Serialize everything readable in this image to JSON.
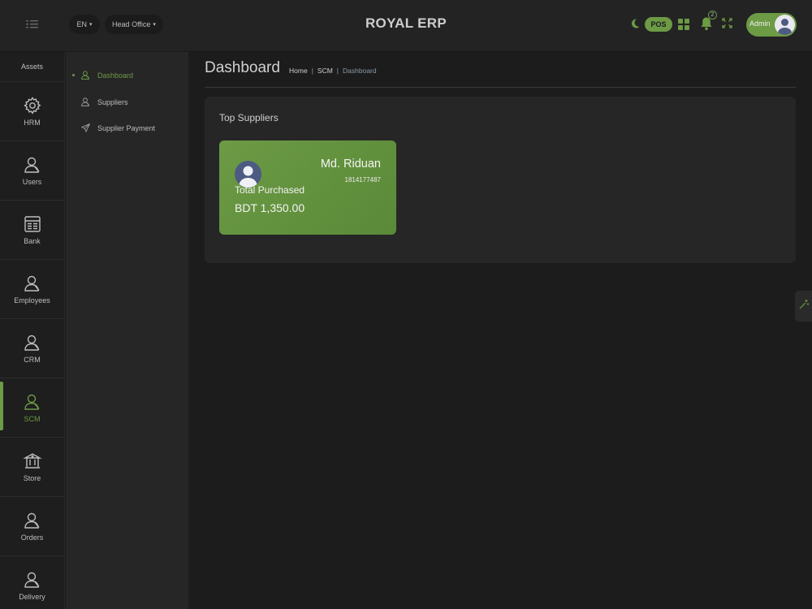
{
  "header": {
    "app_title": "ROYAL ERP",
    "language": "EN",
    "branch": "Head Office",
    "pos_label": "POS",
    "notification_count": "2",
    "admin_label": "Admin"
  },
  "rail": {
    "heading": "Assets",
    "items": [
      {
        "label": "HRM",
        "icon": "gear-icon"
      },
      {
        "label": "Users",
        "icon": "user-icon"
      },
      {
        "label": "Bank",
        "icon": "ledger-icon"
      },
      {
        "label": "Employees",
        "icon": "user-icon"
      },
      {
        "label": "CRM",
        "icon": "user-icon"
      },
      {
        "label": "SCM",
        "icon": "user-icon",
        "active": true
      },
      {
        "label": "Store",
        "icon": "building-icon"
      },
      {
        "label": "Orders",
        "icon": "user-icon"
      },
      {
        "label": "Delivery",
        "icon": "user-icon"
      }
    ]
  },
  "subnav": {
    "items": [
      {
        "label": "Dashboard",
        "icon": "user-icon",
        "active": true
      },
      {
        "label": "Suppliers",
        "icon": "user-icon"
      },
      {
        "label": "Supplier Payment",
        "icon": "send-icon"
      }
    ]
  },
  "page": {
    "title": "Dashboard",
    "breadcrumb": {
      "home": "Home",
      "section": "SCM",
      "current": "Dashboard"
    }
  },
  "top_suppliers": {
    "title": "Top Suppliers",
    "cards": [
      {
        "name": "Md. Riduan",
        "phone": "1814177487",
        "label": "Total Purchased",
        "amount": "BDT 1,350.00"
      }
    ]
  },
  "colors": {
    "accent": "#6c9a45",
    "background": "#1c1c1c",
    "panel": "#262626"
  }
}
